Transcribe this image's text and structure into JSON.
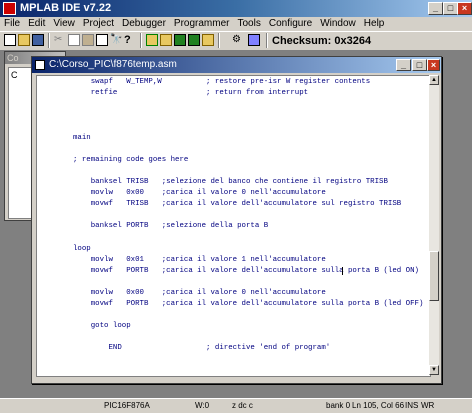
{
  "app": {
    "title": "MPLAB IDE v7.22"
  },
  "menu": [
    "File",
    "Edit",
    "View",
    "Project",
    "Debugger",
    "Programmer",
    "Tools",
    "Configure",
    "Window",
    "Help"
  ],
  "toolbar": {
    "checksum_label": "Checksum:",
    "checksum_value": "0x3264"
  },
  "project_window": {
    "title": "Co",
    "tree_item": "C"
  },
  "editor": {
    "filename": "C:\\Corso_PIC\\f876temp.asm",
    "lines": [
      "    swapf   W_TEMP,W          ; restore pre-isr W register contents",
      "    retfie                    ; return from interrupt",
      "",
      "",
      "",
      "main",
      "",
      "; remaining code goes here",
      "",
      "    banksel TRISB   ;selezione del banco che contiene il registro TRISB",
      "    movlw   0x00    ;carica il valore 0 nell'accumulatore",
      "    movwf   TRISB   ;carica il valore dell'accumulatore sul registro TRISB",
      "",
      "    banksel PORTB   ;selezione della porta B",
      "",
      "loop",
      "    movlw   0x01    ;carica il valore 1 nell'accumulatore",
      "    movwf   PORTB   ;carica il valore dell'accumulatore sulla porta B (led ON)",
      "",
      "    movlw   0x00    ;carica il valore 0 nell'accumulatore",
      "    movwf   PORTB   ;carica il valore dell'accumulatore sulla porta B (led OFF)",
      "",
      "    goto loop",
      "",
      "        END                   ; directive 'end of program'"
    ]
  },
  "status": {
    "device": "PIC16F876A",
    "w": "W:0",
    "flags": "z dc c",
    "bank": "bank 0",
    "position": "Ln 105, Col 66",
    "ins": "INS",
    "wr": "WR"
  },
  "colors": {
    "code_text": "#000080",
    "title_active": "#0a246a",
    "close_button": "#c83820"
  }
}
